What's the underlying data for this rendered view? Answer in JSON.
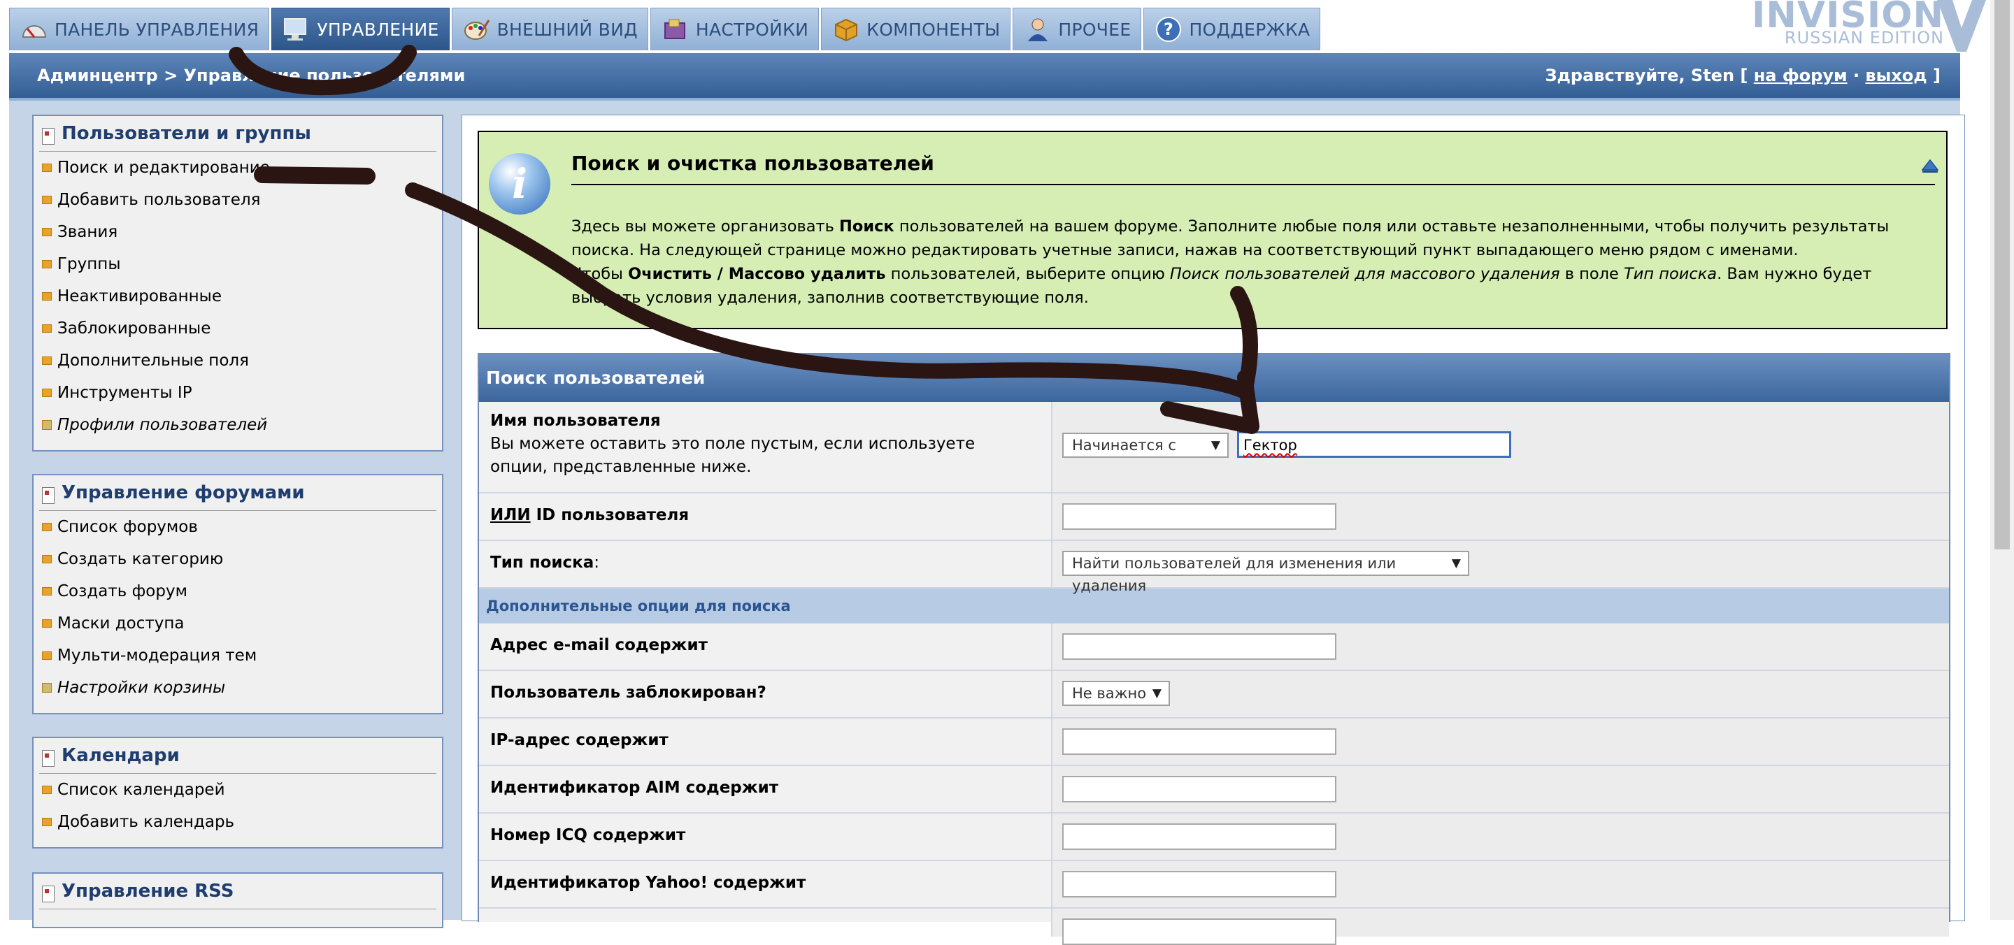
{
  "tabs": [
    {
      "label": "ПАНЕЛЬ УПРАВЛЕНИЯ",
      "icon": "gauge-icon",
      "active": false
    },
    {
      "label": "УПРАВЛЕНИЕ",
      "icon": "monitor-icon",
      "active": true
    },
    {
      "label": "ВНЕШНИЙ ВИД",
      "icon": "palette-icon",
      "active": false
    },
    {
      "label": "НАСТРОЙКИ",
      "icon": "settings-box-icon",
      "active": false
    },
    {
      "label": "КОМПОНЕНТЫ",
      "icon": "package-icon",
      "active": false
    },
    {
      "label": "ПРОЧЕЕ",
      "icon": "user-icon",
      "active": false
    },
    {
      "label": "ПОДДЕРЖКА",
      "icon": "help-icon",
      "active": false
    }
  ],
  "logo": {
    "line1": "INVISION",
    "line2": "RUSSIAN EDITION"
  },
  "navbar": {
    "breadcrumb": "Админцентр > Управление пользователями",
    "greeting": "Здравствуйте, Sten [",
    "forum_link": "на форум",
    "separator": " · ",
    "logout_link": "выход",
    "close_bracket": " ]"
  },
  "sidebar": [
    {
      "title": "Пользователи и группы",
      "items": [
        {
          "label": "Поиск и редактирование",
          "italic": false
        },
        {
          "label": "Добавить пользователя",
          "italic": false
        },
        {
          "label": "Звания",
          "italic": false
        },
        {
          "label": "Группы",
          "italic": false
        },
        {
          "label": "Неактивированные",
          "italic": false
        },
        {
          "label": "Заблокированные",
          "italic": false
        },
        {
          "label": "Дополнительные поля",
          "italic": false
        },
        {
          "label": "Инструменты IP",
          "italic": false
        },
        {
          "label": "Профили пользователей",
          "italic": true
        }
      ]
    },
    {
      "title": "Управление форумами",
      "items": [
        {
          "label": "Список форумов",
          "italic": false
        },
        {
          "label": "Создать категорию",
          "italic": false
        },
        {
          "label": "Создать форум",
          "italic": false
        },
        {
          "label": "Маски доступа",
          "italic": false
        },
        {
          "label": "Мульти-модерация тем",
          "italic": false
        },
        {
          "label": "Настройки корзины",
          "italic": true
        }
      ]
    },
    {
      "title": "Календари",
      "items": [
        {
          "label": "Список календарей",
          "italic": false
        },
        {
          "label": "Добавить календарь",
          "italic": false
        }
      ]
    },
    {
      "title": "Управление RSS",
      "items": []
    }
  ],
  "info": {
    "title": "Поиск и очистка пользователей",
    "p1_a": "Здесь вы можете организовать ",
    "p1_b": "Поиск",
    "p1_c": " пользователей на вашем форуме. Заполните любые поля или оставьте незаполненными, чтобы получить результаты поиска. На следующей странице можно редактировать учетные записи, нажав на соответствующий пункт выпадающего меню рядом с именами.",
    "p2_a": "Чтобы ",
    "p2_b": "Очистить / Массово удалить",
    "p2_c": " пользователей, выберите опцию ",
    "p2_d": "Поиск пользователей для массового удаления",
    "p2_e": " в поле ",
    "p2_f": "Тип поиска",
    "p2_g": ". Вам нужно будет выбрать условия удаления, заполнив соответствующие поля."
  },
  "form": {
    "header": "Поиск пользователей",
    "username_label": "Имя пользователя",
    "username_hint": "Вы можете оставить это поле пустым, если используете опции, представленные ниже.",
    "match_select": "Начинается с",
    "username_value": "Гектор",
    "or_label": "ИЛИ",
    "id_label": " ID пользователя",
    "search_type_label": "Тип поиска",
    "search_type_colon": ":",
    "search_type_value": "Найти пользователей для изменения или удаления",
    "extra_header": "Дополнительные опции для поиска",
    "email_label": "Адрес e-mail содержит",
    "banned_label": "Пользователь заблокирован?",
    "banned_value": "Не важно",
    "ip_label": "IP-адрес содержит",
    "aim_label": "Идентификатор AIM содержит",
    "icq_label": "Номер ICQ содержит",
    "yahoo_label": "Идентификатор Yahoo! содержит"
  },
  "colors": {
    "accent": "#335e95",
    "info_bg": "#d6eeb4",
    "marker": "#2a1512"
  }
}
